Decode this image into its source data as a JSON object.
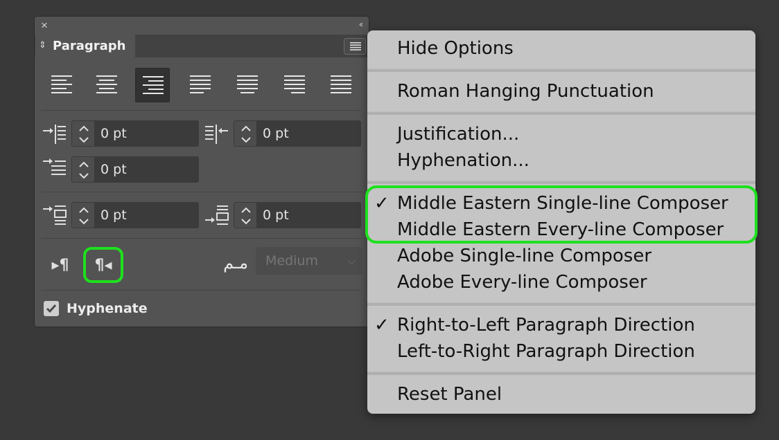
{
  "panel": {
    "tab_label": "Paragraph",
    "close_glyph": "×",
    "collapse_glyph": "‹‹",
    "tab_updown_glyph": "⇕",
    "fields": {
      "left_indent": "0 pt",
      "right_indent": "0 pt",
      "first_line_indent": "0 pt",
      "space_before": "0 pt",
      "space_after": "0 pt"
    },
    "direction_ltr_glyph": "▸¶",
    "direction_rtl_glyph": "¶◂",
    "kashida_glyph": "مـم",
    "kashida_select": "Medium",
    "hyphenate_label": "Hyphenate",
    "hyphenate_checked": true
  },
  "menu": {
    "check_glyph": "✓",
    "items": [
      {
        "label": "Hide Options",
        "checked": false
      },
      {
        "label": "Roman Hanging Punctuation",
        "checked": false
      },
      {
        "label": "Justification...",
        "checked": false
      },
      {
        "label": "Hyphenation...",
        "checked": false
      },
      {
        "label": "Middle Eastern Single-line Composer",
        "checked": true
      },
      {
        "label": "Middle Eastern Every-line Composer",
        "checked": false
      },
      {
        "label": "Adobe Single-line Composer",
        "checked": false
      },
      {
        "label": "Adobe Every-line Composer",
        "checked": false
      },
      {
        "label": "Right-to-Left Paragraph Direction",
        "checked": true
      },
      {
        "label": "Left-to-Right Paragraph Direction",
        "checked": false
      },
      {
        "label": "Reset Panel",
        "checked": false
      }
    ]
  },
  "colors": {
    "highlight": "#1ee01e",
    "panel_bg": "#535353",
    "menu_bg": "#c5c5c5",
    "background": "#393939"
  }
}
